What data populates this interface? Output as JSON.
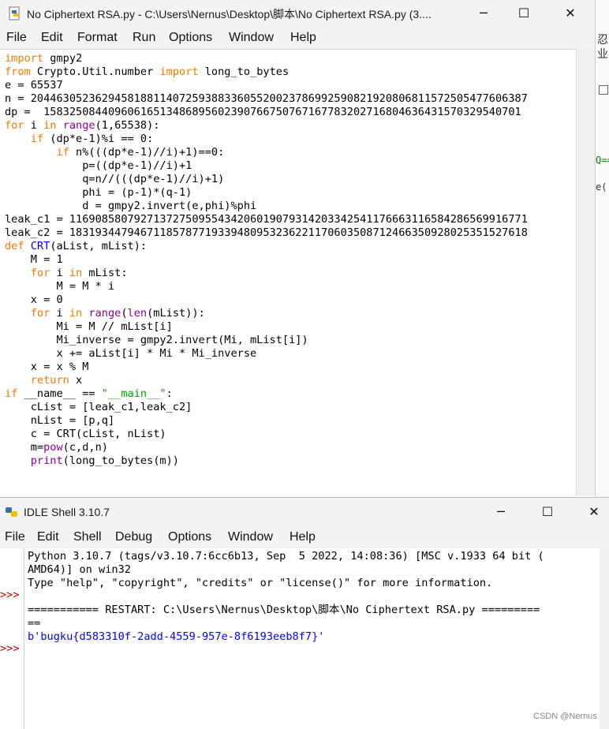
{
  "editor_window": {
    "title": "No Ciphertext RSA.py - C:\\Users\\Nernus\\Desktop\\脚本\\No Ciphertext RSA.py (3....",
    "controls": {
      "minimize": "─",
      "maximize": "☐",
      "close": "✕"
    },
    "menu": [
      "File",
      "Edit",
      "Format",
      "Run",
      "Options",
      "Window",
      "Help"
    ]
  },
  "right_strip_text": [
    "忍",
    "业",
    "Q==",
    "e("
  ],
  "code_lines": [
    [
      {
        "t": "import",
        "c": "kw"
      },
      {
        "t": " gmpy2"
      }
    ],
    [
      {
        "t": "from",
        "c": "kw"
      },
      {
        "t": " Crypto.Util.number "
      },
      {
        "t": "import",
        "c": "kw"
      },
      {
        "t": " long_to_bytes"
      }
    ],
    [
      {
        "t": "e = 65537"
      }
    ],
    [
      {
        "t": "n = 20446305236294581881140725938833605520023786992590821920806811572505477606387"
      }
    ],
    [
      {
        "t": "dp =  15832508440960616513486895602390766750767167783202716804636431570329540701"
      }
    ],
    [
      {
        "t": "for",
        "c": "kw"
      },
      {
        "t": " i "
      },
      {
        "t": "in",
        "c": "kw"
      },
      {
        "t": " "
      },
      {
        "t": "range",
        "c": "bi"
      },
      {
        "t": "(1,65538):"
      }
    ],
    [
      {
        "t": "    "
      },
      {
        "t": "if",
        "c": "kw"
      },
      {
        "t": " (dp*e-1)%i == 0:"
      }
    ],
    [
      {
        "t": "        "
      },
      {
        "t": "if",
        "c": "kw"
      },
      {
        "t": " n%(((dp*e-1)//i)+1)==0:"
      }
    ],
    [
      {
        "t": "            p=((dp*e-1)//i)+1"
      }
    ],
    [
      {
        "t": "            q=n//(((dp*e-1)//i)+1)"
      }
    ],
    [
      {
        "t": "            phi = (p-1)*(q-1)"
      }
    ],
    [
      {
        "t": "            d = gmpy2.invert(e,phi)%phi"
      }
    ],
    [
      {
        "t": "leak_c1 = 11690858079271372750955434206019079314203342541176663116584286569916771"
      }
    ],
    [
      {
        "t": "leak_c2 = 18319344794671185787719339480953236221170603508712466350928025351527618"
      }
    ],
    [
      {
        "t": "def",
        "c": "kw"
      },
      {
        "t": " "
      },
      {
        "t": "CRT",
        "c": "df"
      },
      {
        "t": "(aList, mList):"
      }
    ],
    [
      {
        "t": "    M = 1"
      }
    ],
    [
      {
        "t": "    "
      },
      {
        "t": "for",
        "c": "kw"
      },
      {
        "t": " i "
      },
      {
        "t": "in",
        "c": "kw"
      },
      {
        "t": " mList:"
      }
    ],
    [
      {
        "t": "        M = M * i"
      }
    ],
    [
      {
        "t": "    x = 0"
      }
    ],
    [
      {
        "t": "    "
      },
      {
        "t": "for",
        "c": "kw"
      },
      {
        "t": " i "
      },
      {
        "t": "in",
        "c": "kw"
      },
      {
        "t": " "
      },
      {
        "t": "range",
        "c": "bi"
      },
      {
        "t": "("
      },
      {
        "t": "len",
        "c": "bi"
      },
      {
        "t": "(mList)):"
      }
    ],
    [
      {
        "t": "        Mi = M // mList[i]"
      }
    ],
    [
      {
        "t": "        Mi_inverse = gmpy2.invert(Mi, mList[i])"
      }
    ],
    [
      {
        "t": "        x += aList[i] * Mi * Mi_inverse"
      }
    ],
    [
      {
        "t": "    x = x % M"
      }
    ],
    [
      {
        "t": "    "
      },
      {
        "t": "return",
        "c": "kw"
      },
      {
        "t": " x"
      }
    ],
    [
      {
        "t": "if",
        "c": "kw"
      },
      {
        "t": " __name__ == "
      },
      {
        "t": "\"__main__\"",
        "c": "st"
      },
      {
        "t": ":"
      }
    ],
    [
      {
        "t": "    cList = [leak_c1,leak_c2]"
      }
    ],
    [
      {
        "t": "    nList = [p,q]"
      }
    ],
    [
      {
        "t": "    c = CRT(cList, nList)"
      }
    ],
    [
      {
        "t": "    m="
      },
      {
        "t": "pow",
        "c": "bi"
      },
      {
        "t": "(c,d,n)"
      }
    ],
    [
      {
        "t": "    "
      },
      {
        "t": "print",
        "c": "bi"
      },
      {
        "t": "(long_to_bytes(m))"
      }
    ]
  ],
  "shell_window": {
    "title": "IDLE Shell 3.10.7",
    "controls": {
      "minimize": "─",
      "maximize": "☐",
      "close": "✕"
    },
    "menu": [
      "File",
      "Edit",
      "Shell",
      "Debug",
      "Options",
      "Window",
      "Help"
    ],
    "prompt": ">>>",
    "lines": [
      {
        "t": "Python 3.10.7 (tags/v3.10.7:6cc6b13, Sep  5 2022, 14:08:36) [MSC v.1933 64 bit ("
      },
      {
        "t": "AMD64)] on win32"
      },
      {
        "t": "Type \"help\", \"copyright\", \"credits\" or \"license()\" for more information."
      },
      {
        "t": ""
      },
      {
        "t": "=========== RESTART: C:\\Users\\Nernus\\Desktop\\脚本\\No Ciphertext RSA.py ========="
      },
      {
        "t": "=="
      },
      {
        "t": "b'bugku{d583310f-2add-4559-957e-8f6193eeb8f7}'",
        "c": "out"
      }
    ]
  },
  "watermark": "CSDN @Nernus"
}
